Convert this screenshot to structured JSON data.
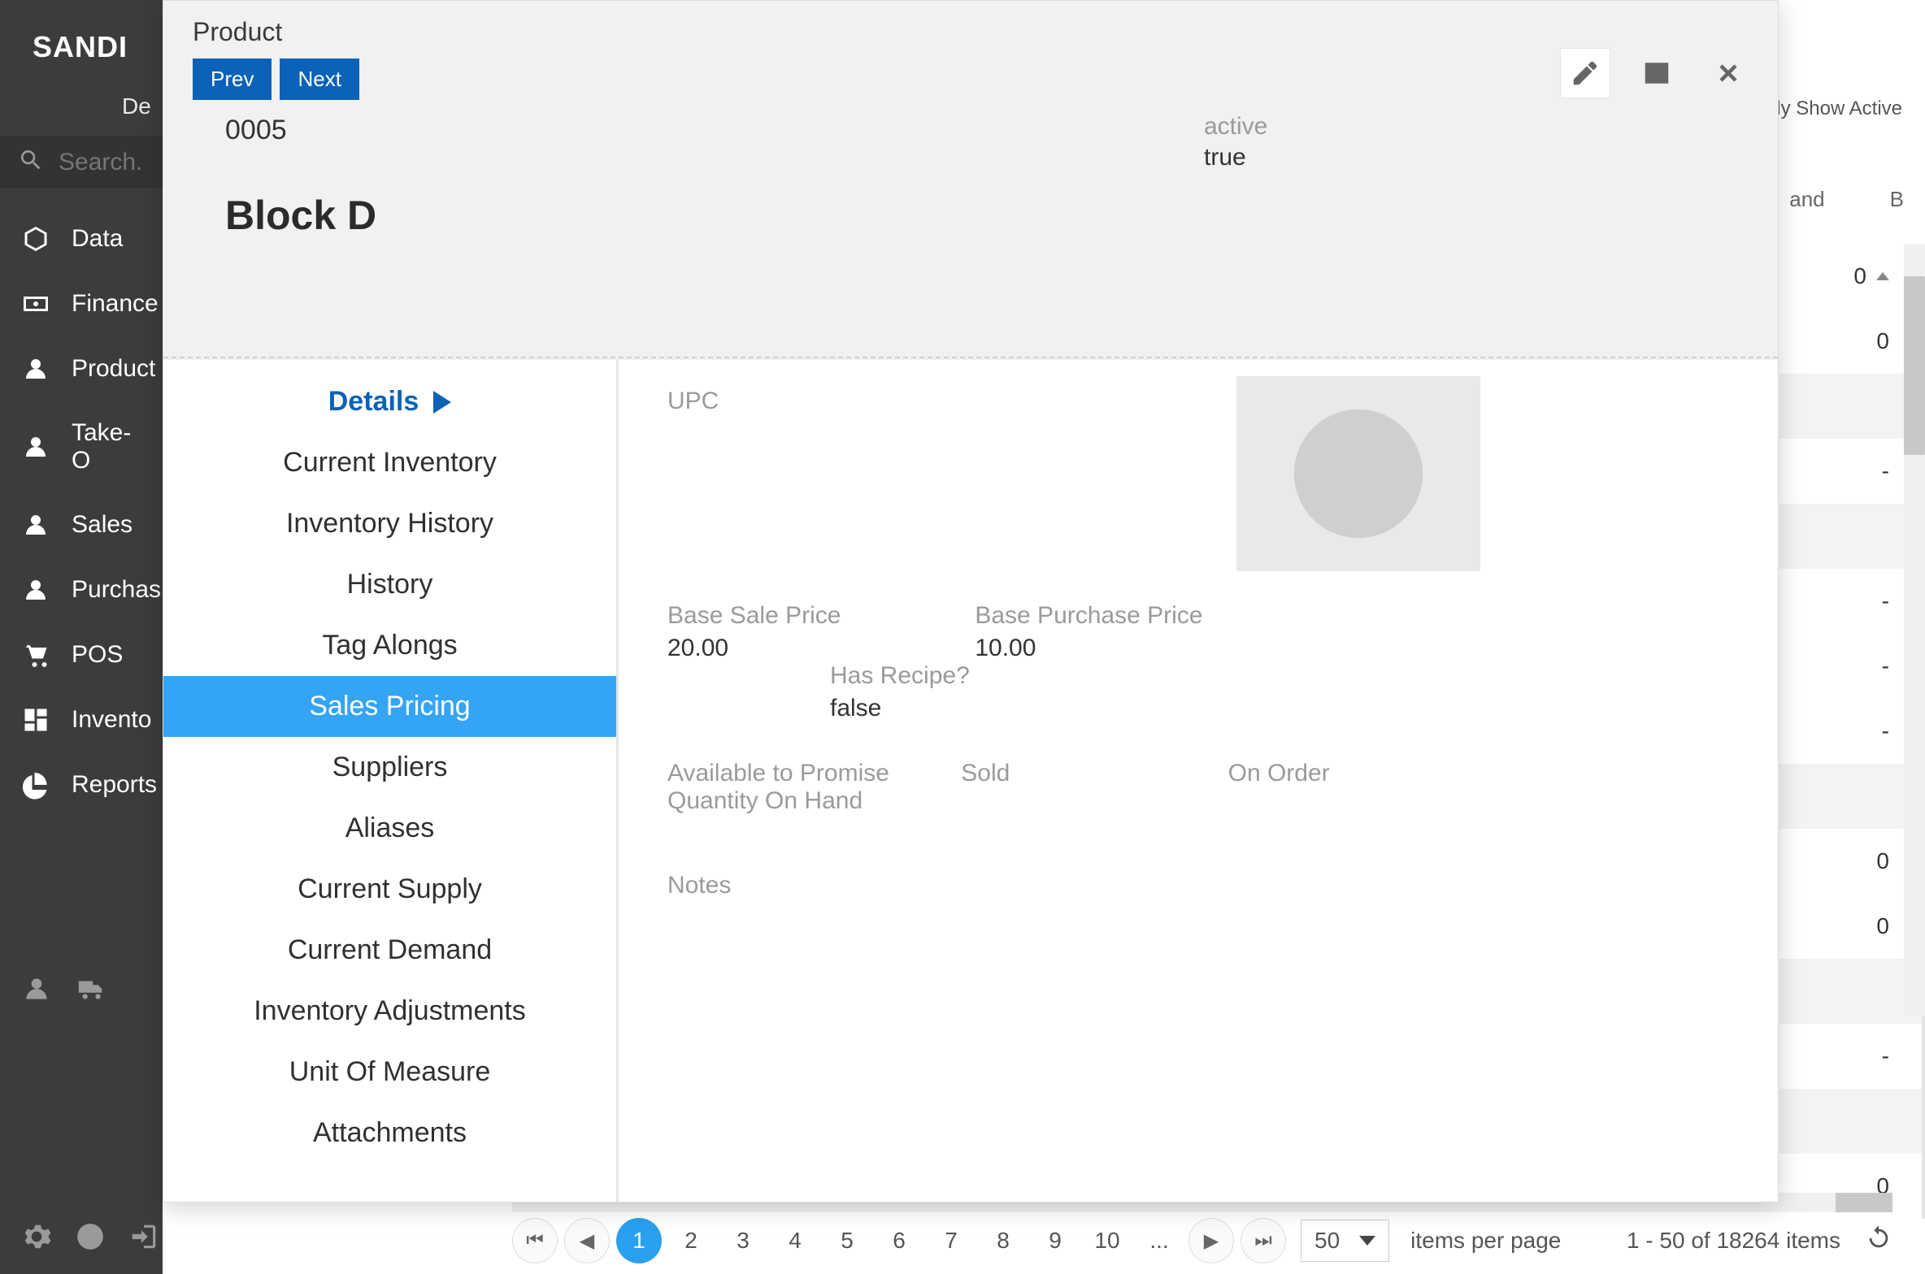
{
  "brand": "SANDI",
  "org": "De",
  "search_placeholder": "Search...",
  "nav": [
    {
      "icon": "cube",
      "label": "Data"
    },
    {
      "icon": "money",
      "label": "Finance"
    },
    {
      "icon": "group",
      "label": "Product"
    },
    {
      "icon": "group",
      "label": "Take-O"
    },
    {
      "icon": "group",
      "label": "Sales"
    },
    {
      "icon": "group",
      "label": "Purchas"
    },
    {
      "icon": "cart",
      "label": "POS"
    },
    {
      "icon": "boxes",
      "label": "Invento"
    },
    {
      "icon": "pie",
      "label": "Reports"
    }
  ],
  "only_show_active": "Only Show Active",
  "grid_headers": {
    "col1": "and",
    "col2": "B"
  },
  "grid_values": [
    "0",
    "0",
    "",
    "-",
    "",
    "-",
    "-",
    "-",
    "",
    "0",
    "0",
    "",
    "-",
    "",
    "0",
    "",
    ""
  ],
  "pager": {
    "pages": [
      "1",
      "2",
      "3",
      "4",
      "5",
      "6",
      "7",
      "8",
      "9",
      "10",
      "..."
    ],
    "active": "1",
    "page_size": "50",
    "label": "items per page",
    "summary": "1 - 50 of 18264 items"
  },
  "modal": {
    "title": "Product",
    "prev": "Prev",
    "next": "Next",
    "id": "0005",
    "name": "Block D",
    "active_label": "active",
    "active_value": "true",
    "sections": [
      "Details",
      "Current Inventory",
      "Inventory History",
      "History",
      "Tag Alongs",
      "Sales Pricing",
      "Suppliers",
      "Aliases",
      "Current Supply",
      "Current Demand",
      "Inventory Adjustments",
      "Unit Of Measure",
      "Attachments"
    ],
    "selected_section": "Sales Pricing",
    "details": {
      "upc_label": "UPC",
      "base_sale_label": "Base Sale Price",
      "base_sale_value": "20.00",
      "base_purchase_label": "Base Purchase Price",
      "base_purchase_value": "10.00",
      "has_recipe_label": "Has Recipe?",
      "has_recipe_value": "false",
      "atp_label": "Available to Promise",
      "sold_label": "Sold",
      "on_order_label": "On Order",
      "qoh_label": "Quantity On Hand",
      "notes_label": "Notes"
    }
  }
}
